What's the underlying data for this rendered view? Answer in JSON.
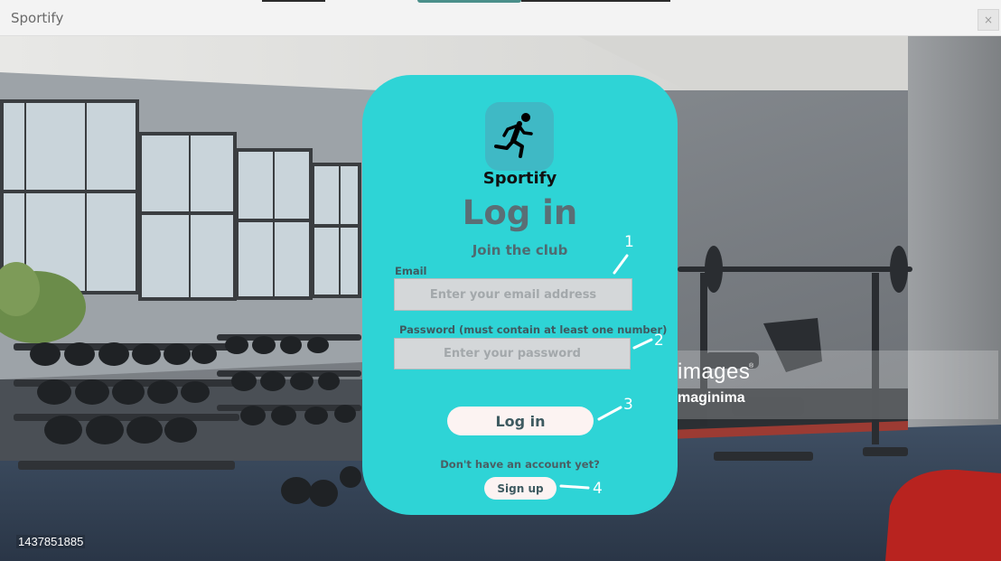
{
  "window": {
    "title": "Sportify",
    "close_glyph": "×"
  },
  "background": {
    "image_id_text": "1437851885",
    "watermark_text": "images",
    "watermark_reg": "®",
    "watermark_brand": "maginima"
  },
  "login": {
    "logo_icon": "running-person-icon",
    "app_name": "Sportify",
    "heading": "Log in",
    "subheading": "Join the club",
    "email_label": "Email",
    "email_placeholder": "Enter your email address",
    "email_value": "",
    "password_label": "Password (must contain at least one number)",
    "password_placeholder": "Enter your password",
    "password_value": "",
    "login_button": "Log in",
    "no_account_text": "Don't have an account yet?",
    "signup_button": "Sign up"
  },
  "annotations": [
    "1",
    "2",
    "3",
    "4"
  ],
  "colors": {
    "card": "#2ed4d6",
    "logo_tile": "#3fb9c5",
    "button_bg": "#fcf3f2",
    "field_bg": "#d4d7d9",
    "heading_text": "#5a6e75"
  }
}
